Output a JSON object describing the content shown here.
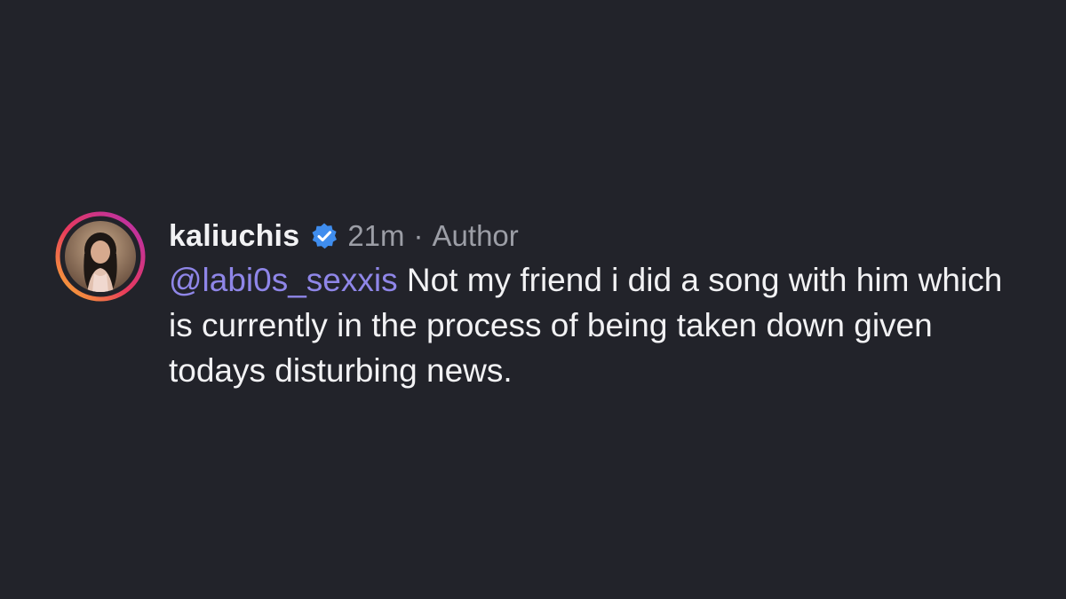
{
  "comment": {
    "username": "kaliuchis",
    "verified": true,
    "time": "21m",
    "separator": "·",
    "role": "Author",
    "mention": "@labi0s_sexxis",
    "text": " Not my friend i did a song with him which is currently in the process of being taken down given todays disturbing news.",
    "colors": {
      "background": "#22232a",
      "text": "#f2f2f4",
      "muted": "#9c9ea6",
      "mention": "#8f86e8",
      "verified": "#3f8dee"
    },
    "icons": {
      "avatar": "profile-photo-with-story-ring",
      "verified": "verified-badge-icon"
    }
  }
}
